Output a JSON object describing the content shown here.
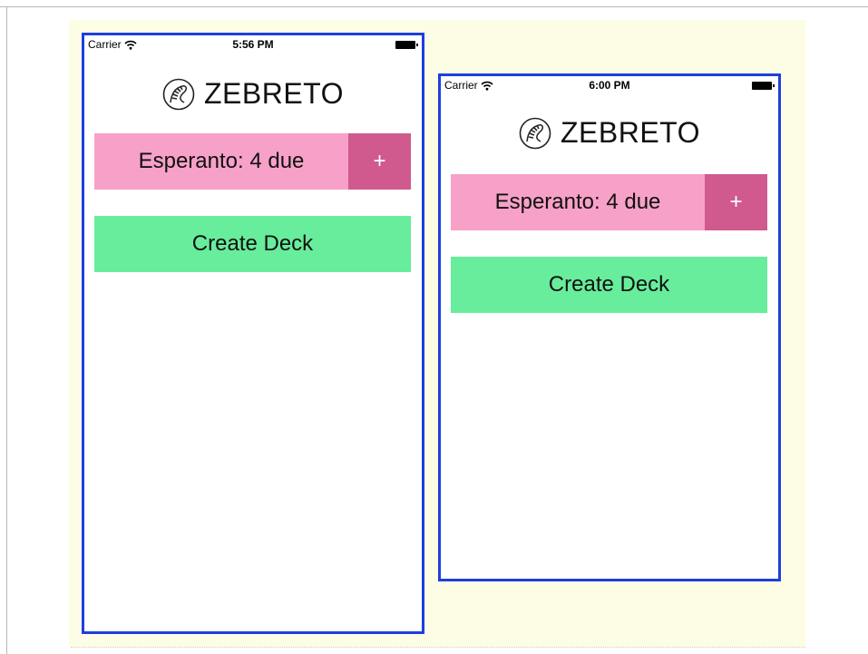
{
  "screens": [
    {
      "status": {
        "carrier": "Carrier",
        "time": "5:56 PM"
      },
      "app": {
        "title": "ZEBRETO"
      },
      "deck": {
        "label": "Esperanto: 4 due",
        "add_label": "+"
      },
      "create_label": "Create Deck"
    },
    {
      "status": {
        "carrier": "Carrier",
        "time": "6:00 PM"
      },
      "app": {
        "title": "ZEBRETO"
      },
      "deck": {
        "label": "Esperanto: 4 due",
        "add_label": "+"
      },
      "create_label": "Create Deck"
    }
  ],
  "icons": {
    "logo": "zebra-logo-icon",
    "wifi": "wifi-icon",
    "battery": "battery-icon"
  },
  "colors": {
    "deck_bg": "#f7a1c8",
    "deck_add_bg": "#d05a8e",
    "create_bg": "#67ed9b",
    "phone_border": "#1e3ee0",
    "page_bg": "#fdfde6"
  }
}
